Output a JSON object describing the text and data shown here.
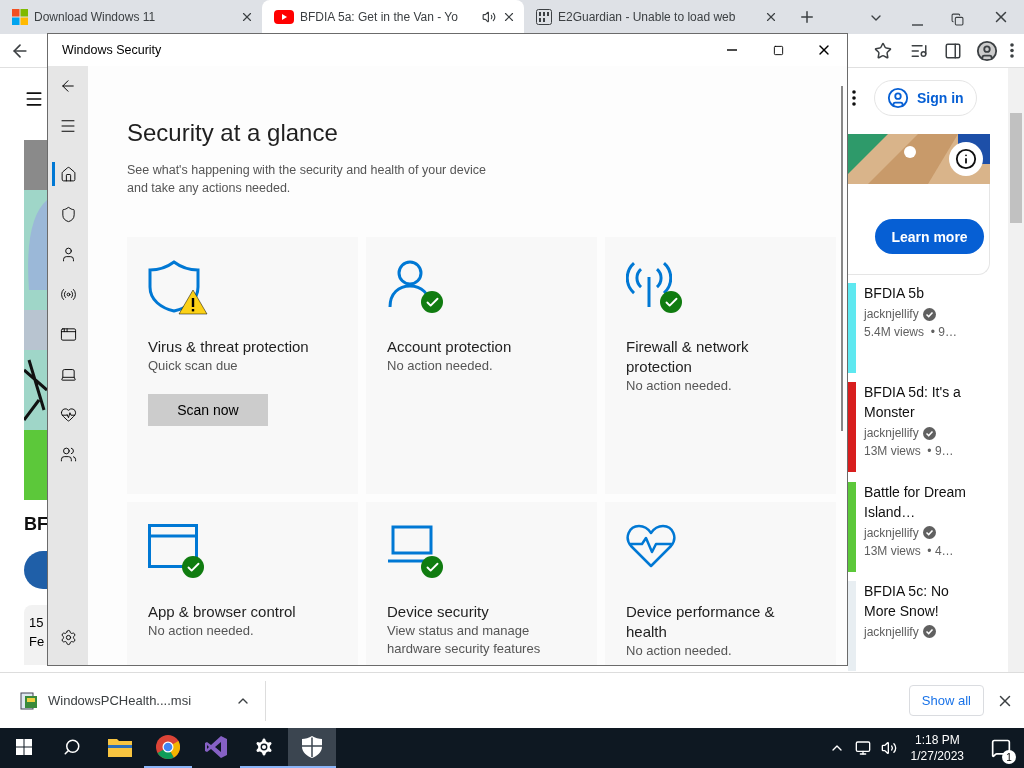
{
  "browser": {
    "tabs": [
      {
        "kind": "windows",
        "title": "Download Windows 11",
        "selected": false,
        "audio": false
      },
      {
        "kind": "youtube",
        "title": "BFDIA 5a: Get in the Van - Yo",
        "selected": true,
        "audio": true
      },
      {
        "kind": "binary",
        "title": "E2Guardian - Unable to load web",
        "selected": false,
        "audio": false
      }
    ],
    "page": {
      "left_title": "BF",
      "left_stats": [
        "15",
        "Fe"
      ],
      "sign_in": "Sign in",
      "ad_button": "Learn more",
      "videos": [
        {
          "title": "BFDIA 5b",
          "channel": "jacknjellify",
          "meta": "5.4M views  • 9…",
          "color": "#5ee8f0"
        },
        {
          "title": "BFDIA 5d: It's a Monster",
          "channel": "jacknjellify",
          "meta": "13M views  • 9…",
          "color": "#d81e1e"
        },
        {
          "title": "Battle for Dream Island…",
          "channel": "jacknjellify",
          "meta": "13M views  • 4…",
          "color": "#5cc83a"
        },
        {
          "title": "BFDIA 5c: No More Snow!",
          "channel": "jacknjellify",
          "color": "#e8eef2"
        }
      ]
    },
    "downloads": {
      "file": "WindowsPCHealth....msi",
      "show_all": "Show all"
    }
  },
  "security_window": {
    "title": "Windows Security",
    "heading": "Security at a glance",
    "description": "See what's happening with the security and health of your device and take any actions needed.",
    "nav": [
      {
        "kind": "home",
        "selected": true
      },
      {
        "kind": "shield",
        "selected": false
      },
      {
        "kind": "person",
        "selected": false
      },
      {
        "kind": "antenna",
        "selected": false
      },
      {
        "kind": "browser",
        "selected": false
      },
      {
        "kind": "laptop",
        "selected": false
      },
      {
        "kind": "heart",
        "selected": false
      },
      {
        "kind": "family",
        "selected": false
      }
    ],
    "tiles": [
      {
        "kind": "shield",
        "warning": true,
        "ok": false,
        "title": "Virus & threat protection",
        "subtitle": "Quick scan due",
        "action": "Scan now"
      },
      {
        "kind": "person",
        "warning": false,
        "ok": true,
        "title": "Account protection",
        "subtitle": "No action needed."
      },
      {
        "kind": "antenna",
        "warning": false,
        "ok": true,
        "title": "Firewall & network protection",
        "subtitle": "No action needed."
      },
      {
        "kind": "browser",
        "warning": false,
        "ok": true,
        "title": "App & browser control",
        "subtitle": "No action needed."
      },
      {
        "kind": "laptop",
        "warning": false,
        "ok": true,
        "title": "Device security",
        "subtitle": "View status and manage hardware security features"
      },
      {
        "kind": "heart",
        "warning": false,
        "ok": false,
        "title": "Device performance & health",
        "subtitle": "No action needed."
      }
    ]
  },
  "taskbar": {
    "apps": [
      {
        "kind": "explorer",
        "running": false,
        "selected": false
      },
      {
        "kind": "chrome",
        "running": true,
        "selected": false
      },
      {
        "kind": "studio",
        "running": false,
        "selected": false
      },
      {
        "kind": "settings",
        "running": true,
        "selected": false
      },
      {
        "kind": "security",
        "running": true,
        "selected": true
      }
    ],
    "time": "1:18 PM",
    "date": "1/27/2023",
    "notifications": "1"
  }
}
